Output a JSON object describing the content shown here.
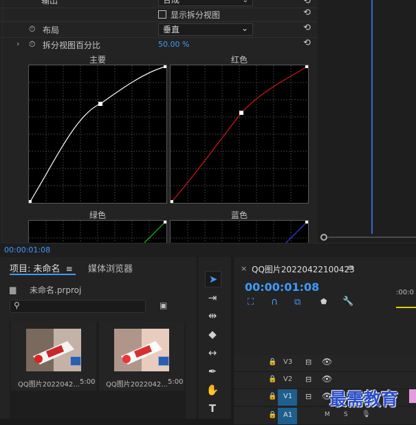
{
  "effect_controls": {
    "output_label": "输出",
    "output_value": "合成",
    "show_split_label": "显示拆分视图",
    "layout_label": "布局",
    "layout_value": "垂直",
    "split_percent_label": "拆分视图百分比",
    "split_percent_value": "50.00 %",
    "curves": [
      {
        "label": "主要",
        "color": "#ffffff"
      },
      {
        "label": "红色",
        "color": "#e02020"
      },
      {
        "label": "绿色",
        "color": "#20c020"
      },
      {
        "label": "蓝色",
        "color": "#3040ff"
      }
    ],
    "timecode": "00:00:01:08"
  },
  "project": {
    "tab_project": "项目: 未命名",
    "tab_media_browser": "媒体浏览器",
    "file_name": "未命名.prproj",
    "search_placeholder": "",
    "items": [
      {
        "name": "QQ图片2022042...",
        "duration": "5:00"
      },
      {
        "name": "QQ图片2022042...",
        "duration": "5:00"
      }
    ]
  },
  "timeline": {
    "tab_title": "QQ图片20220422100423",
    "timecode": "00:00:01:08",
    "ruler_time": ":00:0",
    "tracks": [
      {
        "name": "V3",
        "label": "V3"
      },
      {
        "name": "V2",
        "label": "V2"
      },
      {
        "name": "V1",
        "label": "V1"
      },
      {
        "name": "A1",
        "label": "A1"
      }
    ],
    "a1_m": "M",
    "a1_s": "S"
  },
  "watermark": "最需教育",
  "colors": {
    "accent": "#3f9bff",
    "panel": "#232323",
    "background": "#1a1a1a"
  }
}
